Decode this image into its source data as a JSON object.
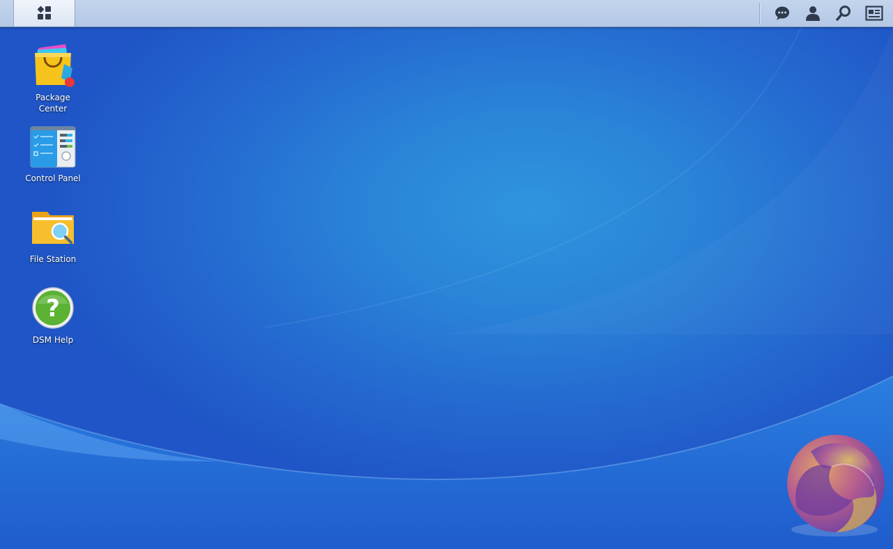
{
  "taskbar": {
    "main_menu_icon": "grid-icon",
    "tray": [
      {
        "name": "notifications-icon"
      },
      {
        "name": "user-icon"
      },
      {
        "name": "search-icon"
      },
      {
        "name": "widgets-icon"
      }
    ]
  },
  "desktop": {
    "shortcuts": [
      {
        "label": "Package\nCenter",
        "icon": "package-center-icon"
      },
      {
        "label": "Control Panel",
        "icon": "control-panel-icon"
      },
      {
        "label": "File Station",
        "icon": "file-station-icon"
      },
      {
        "label": "DSM Help",
        "icon": "dsm-help-icon"
      }
    ]
  },
  "colors": {
    "wallpaper": "#2a83d8",
    "taskbar": "#b9cce8",
    "label": "#ffffff"
  }
}
